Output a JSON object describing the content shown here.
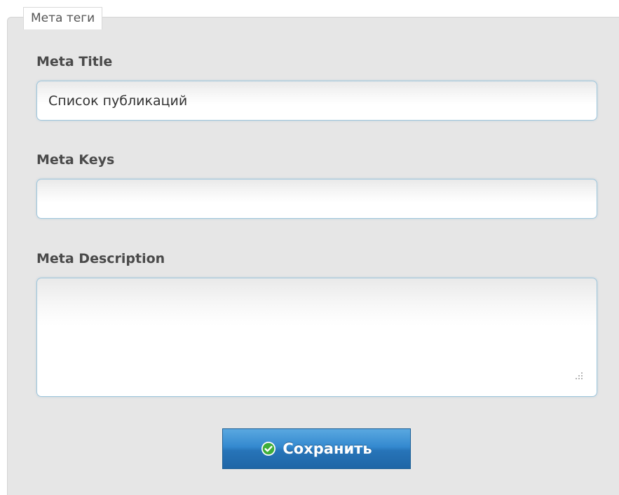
{
  "fieldset": {
    "legend": "Мета теги"
  },
  "fields": {
    "meta_title": {
      "label": "Meta Title",
      "value": "Список публикаций"
    },
    "meta_keys": {
      "label": "Meta Keys",
      "value": ""
    },
    "meta_description": {
      "label": "Meta Description",
      "value": ""
    }
  },
  "actions": {
    "save_label": "Сохранить",
    "save_icon": "check-circle-icon"
  },
  "colors": {
    "panel_background": "#e6e6e6",
    "input_border": "#9fc6dc",
    "button_blue": "#2774b8",
    "check_green": "#3fae3a"
  }
}
